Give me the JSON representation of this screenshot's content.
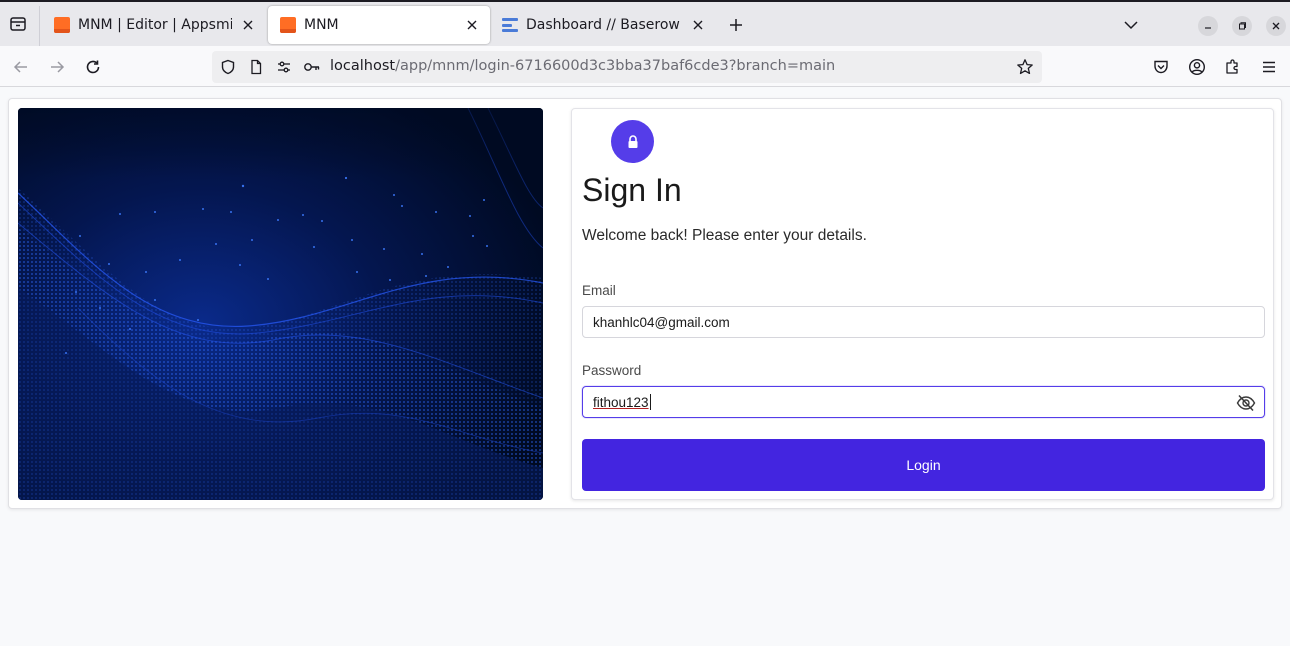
{
  "browser": {
    "tabs": [
      {
        "title": "MNM | Editor | Appsmith",
        "favicon": "appsmith-orange-icon",
        "active": false
      },
      {
        "title": "MNM",
        "favicon": "appsmith-orange-icon",
        "active": true
      },
      {
        "title": "Dashboard // Baserow",
        "favicon": "baserow-icon",
        "active": false
      }
    ],
    "url": {
      "host": "localhost",
      "path": "/app/mnm/login-6716600d3c3bba37baf6cde3?branch=main"
    }
  },
  "login": {
    "title": "Sign In",
    "subtitle": "Welcome back! Please enter your details.",
    "email_label": "Email",
    "email_value": "khanhlc04@gmail.com",
    "password_label": "Password",
    "password_value": "fithou123",
    "button_label": "Login"
  },
  "colors": {
    "accent": "#553de9",
    "button": "#4325e0",
    "hero_background": "#000d2a",
    "hero_wave": "#1a4cff"
  }
}
